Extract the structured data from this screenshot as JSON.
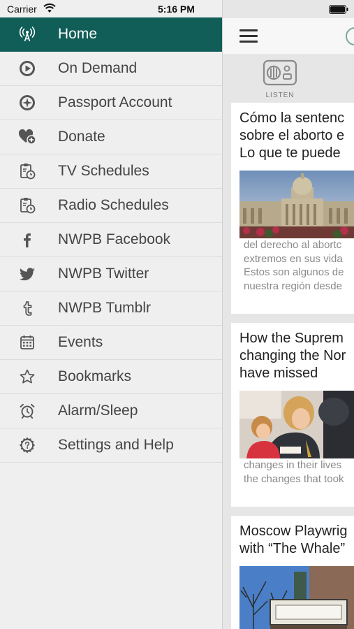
{
  "status_bar": {
    "carrier": "Carrier",
    "time": "5:16 PM"
  },
  "drawer": {
    "items": [
      {
        "label": "Home",
        "icon": "antenna-icon"
      },
      {
        "label": "On Demand",
        "icon": "play-circle-icon"
      },
      {
        "label": "Passport Account",
        "icon": "compass-icon"
      },
      {
        "label": "Donate",
        "icon": "heart-plus-icon"
      },
      {
        "label": "TV Schedules",
        "icon": "clipboard-clock-icon"
      },
      {
        "label": "Radio Schedules",
        "icon": "clipboard-clock-icon"
      },
      {
        "label": "NWPB Facebook",
        "icon": "facebook-icon"
      },
      {
        "label": "NWPB Twitter",
        "icon": "twitter-icon"
      },
      {
        "label": "NWPB Tumblr",
        "icon": "tumblr-icon"
      },
      {
        "label": "Events",
        "icon": "calendar-icon"
      },
      {
        "label": "Bookmarks",
        "icon": "star-icon"
      },
      {
        "label": "Alarm/Sleep",
        "icon": "alarm-clock-icon"
      },
      {
        "label": "Settings and Help",
        "icon": "help-icon"
      }
    ],
    "active_color": "#115d58"
  },
  "main": {
    "listen_label": "LISTEN",
    "articles": [
      {
        "title_lines": [
          "Cómo la sentenc",
          "sobre el aborto e",
          "Lo que te puede"
        ],
        "excerpt_lines": [
          "del derecho al abortc",
          "extremos en sus vida",
          "Estos son algunos de",
          "nuestra región desde"
        ]
      },
      {
        "title_lines": [
          "How the Suprem",
          "changing the Nor",
          "have missed"
        ],
        "excerpt_lines": [
          "changes in their lives",
          "the changes that took"
        ]
      },
      {
        "title_lines": [
          "Moscow Playwrig",
          "with “The Whale”"
        ],
        "excerpt_lines": []
      }
    ]
  }
}
